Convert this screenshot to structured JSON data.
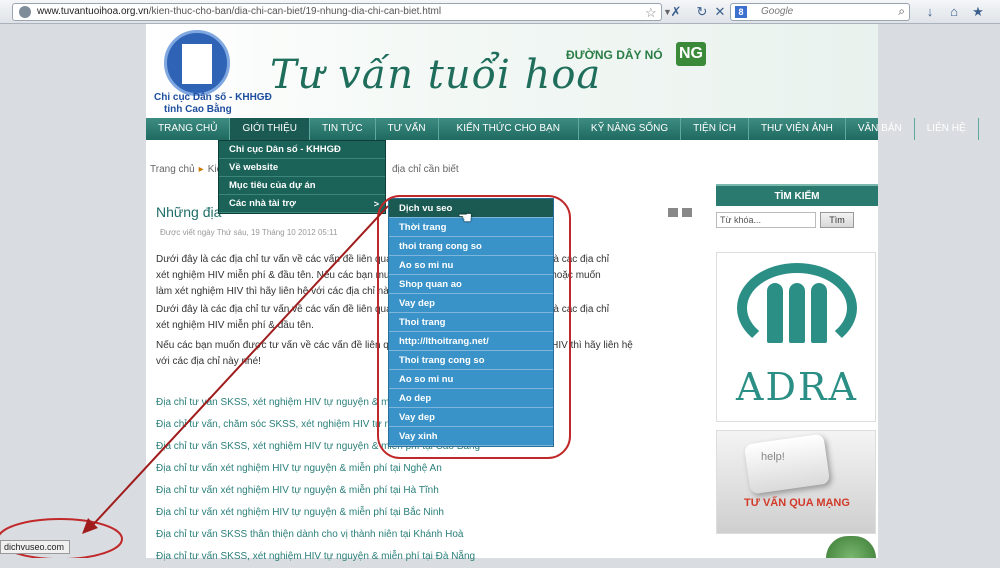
{
  "browser": {
    "url_prefix": "www.tuvantuoihoa.org.vn",
    "url_path": "/kien-thuc-cho-ban/dia-chi-can-biet/19-nhung-dia-chi-can-biet.html",
    "search_placeholder": "Google",
    "search_engine_label": "8",
    "star_icon": "star-icon",
    "status_text": "dichvuseo.com"
  },
  "banner": {
    "logo_text1": "Chi cục Dân số - KHHGĐ",
    "logo_text2": "tỉnh Cao Bằng",
    "site_title": "Tư vấn tuổi hoa",
    "hotline_label": "ĐƯỜNG DÂY NÓ",
    "hotline_badge": "NG"
  },
  "nav": {
    "items": [
      {
        "label": "TRANG CHỦ"
      },
      {
        "label": "GIỚI THIỆU"
      },
      {
        "label": "TIN TỨC"
      },
      {
        "label": "TƯ VẤN"
      },
      {
        "label": "KIẾN THỨC CHO BẠN"
      },
      {
        "label": "KỸ NĂNG SỐNG"
      },
      {
        "label": "TIỆN ÍCH"
      },
      {
        "label": "THƯ VIỆN ẢNH"
      },
      {
        "label": "VĂN BẢN"
      },
      {
        "label": "LIÊN HỆ"
      }
    ]
  },
  "breadcrumb": {
    "home": "Trang chủ",
    "second": "Kiế",
    "tail": "địa chỉ cần biết"
  },
  "dropdown_primary": {
    "items": [
      "Chi cục Dân số - KHHGĐ",
      "Về website",
      "Mục tiêu của dự án",
      "Các nhà tài trợ"
    ],
    "submenu_arrow": ">"
  },
  "dropdown_secondary": {
    "items": [
      "Dịch vu seo",
      "Thời trang",
      "thoi trang cong so",
      "Ao so mi nu",
      "Shop quan ao",
      "Vay dep",
      "Thoi trang",
      "http://lthoitrang.net/",
      "Thoi trang cong so",
      "Ao so mi nu",
      "Ao dep",
      "Vay dep",
      "Vay xinh"
    ]
  },
  "article": {
    "title": "Những địa",
    "date": "Được viết ngày Thứ sáu, 19 Tháng 10 2012 05:11",
    "para1_a": "Dưới đây là các địa chỉ tư vấn về các vấn đề liên quan",
    "para1_b": "cho vị thành niên và các địa chỉ",
    "para1_c": "xét nghiệm HIV miễn phí & đầu tên. Nếu các bạn muốn",
    "para1_d": "ến sức khoẻ sinh sản hoặc muốn",
    "para1_e": "làm xét nghiệm HIV thì hãy liên hệ với các địa chỉ này",
    "para2_a": "Dưới đây là các địa chỉ tư vấn về các vấn đề liên quan",
    "para2_b": "cho vị thành niên và các địa chỉ",
    "para2_c": "xét nghiệm HIV miễn phí & đầu tên.",
    "para3_a": "Nếu các bạn muốn được tư vấn về các vấn đề liên quan",
    "para3_b": "m xét nghiệm HIV thì hãy liên hệ",
    "para3_c": "với các địa chỉ này nhé!",
    "links": [
      "Địa chỉ tư vấn SKSS, xét nghiệm HIV tự nguyện & miễ",
      "Địa chỉ tư vấn, chăm sóc SKSS, xét nghiệm HIV tự ng",
      "Địa chỉ tư vấn SKSS, xét nghiệm HIV tự nguyện & miễn phí tại Cao Bằng",
      "Địa chỉ tư vấn xét nghiệm HIV tự nguyện & miễn phí tại Nghệ An",
      "Địa chỉ tư vấn xét nghiệm HIV tự nguyện & miễn phí tại Hà Tĩnh",
      "Địa chỉ tư vấn xét nghiệm HIV tự nguyện & miễn phí tại Bắc Ninh",
      "Địa chỉ tư vấn SKSS thân thiện dành cho vị thành niên tại Khánh Hoà",
      "Địa chỉ tư vấn SKSS, xét nghiệm HIV tự nguyện & miễn phí tại Đà Nẵng"
    ]
  },
  "sidebar": {
    "search_heading": "TÌM KIẾM",
    "search_placeholder": "Từ khóa...",
    "search_button": "Tìm",
    "adra_text": "ADRA",
    "help_key": "help!",
    "tuvan_label": "TƯ VẤN QUA MẠNG"
  },
  "colors": {
    "nav_bg": "#2a7a70",
    "submenu_bg": "#3a93c8",
    "annotation": "#c0282a"
  }
}
